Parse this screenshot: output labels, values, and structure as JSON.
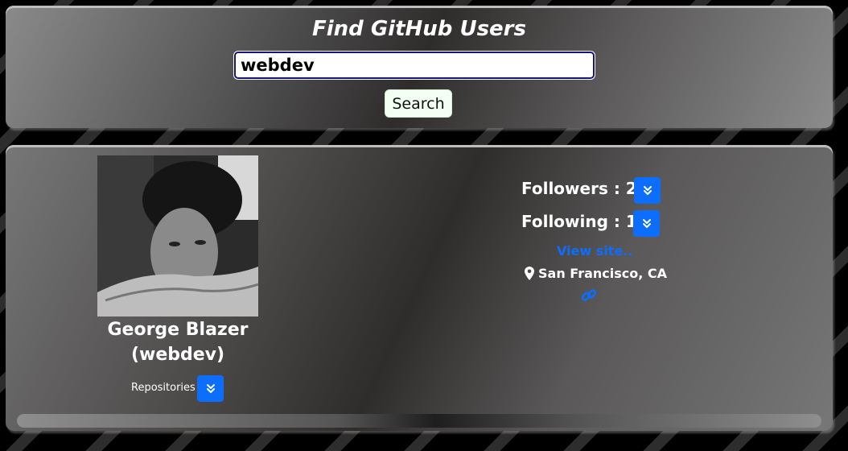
{
  "header": {
    "title": "Find GitHub Users"
  },
  "search": {
    "value": "webdev",
    "button_label": "Search"
  },
  "profile": {
    "name": "George Blazer",
    "login": "(webdev)",
    "repositories_label": "Repositories",
    "followers_label": "Followers : 29",
    "following_label": "Following : 17",
    "site_link": "View site..",
    "location": "San Francisco, CA"
  },
  "icons": {
    "expand": "chevron-double-down-icon",
    "location": "map-pin-icon",
    "link": "link-icon"
  },
  "colors": {
    "accent": "#0d6efd",
    "input_border": "#14147a"
  }
}
